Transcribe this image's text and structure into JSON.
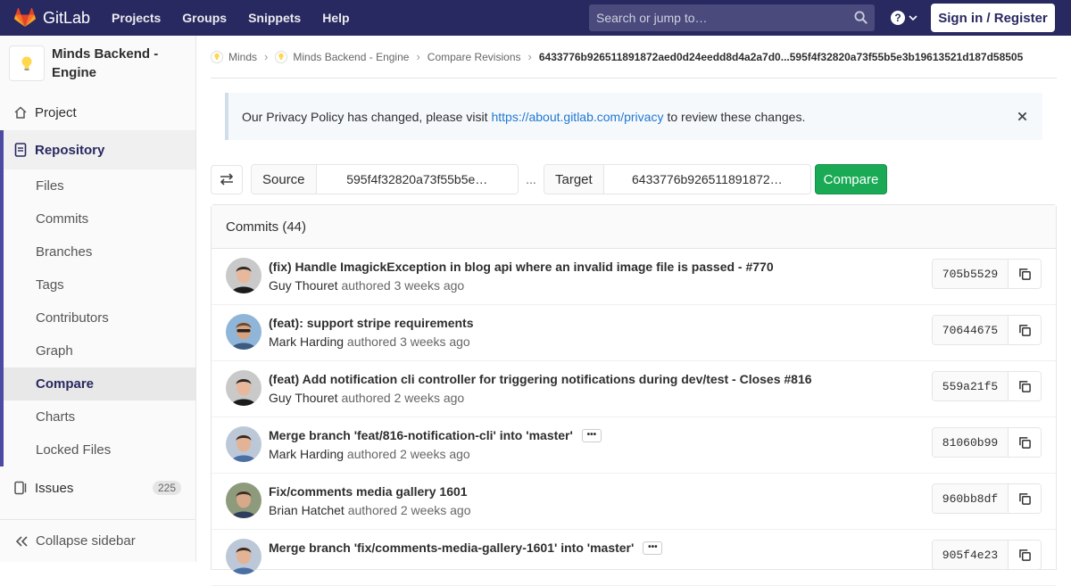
{
  "navbar": {
    "brand": "GitLab",
    "links": [
      "Projects",
      "Groups",
      "Snippets",
      "Help"
    ],
    "search_placeholder": "Search or jump to…",
    "signin": "Sign in / Register"
  },
  "sidebar": {
    "project_name": "Minds Backend - Engine",
    "project_label": "Project",
    "repository_label": "Repository",
    "repo_items": [
      "Files",
      "Commits",
      "Branches",
      "Tags",
      "Contributors",
      "Graph",
      "Compare",
      "Charts",
      "Locked Files"
    ],
    "current_item": "Compare",
    "issues_label": "Issues",
    "issues_count": "225",
    "collapse_label": "Collapse sidebar"
  },
  "breadcrumb": {
    "items": [
      "Minds",
      "Minds Backend - Engine",
      "Compare Revisions"
    ],
    "current": "6433776b926511891872aed0d24eedd8d4a2a7d0...595f4f32820a73f55b5e3b19613521d187d58505"
  },
  "alert": {
    "text_before": "Our Privacy Policy has changed, please visit",
    "link": "https://about.gitlab.com/privacy",
    "text_after": "to review these changes."
  },
  "compare": {
    "source_label": "Source",
    "source_value": "595f4f32820a73f55b5e…",
    "ellipsis": "...",
    "target_label": "Target",
    "target_value": "6433776b926511891872…",
    "button": "Compare"
  },
  "commits": {
    "header": "Commits (44)",
    "rows": [
      {
        "title": "(fix) Handle ImagickException in blog api where an invalid image file is passed - #770",
        "author": "Guy Thouret",
        "time": "authored 3 weeks ago",
        "sha": "705b5529",
        "avatar": "guy",
        "more": false
      },
      {
        "title": "(feat): support stripe requirements",
        "author": "Mark Harding",
        "time": "authored 3 weeks ago",
        "sha": "70644675",
        "avatar": "mark-sun",
        "more": false
      },
      {
        "title": "(feat) Add notification cli controller for triggering notifications during dev/test - Closes #816",
        "author": "Guy Thouret",
        "time": "authored 2 weeks ago",
        "sha": "559a21f5",
        "avatar": "guy",
        "more": false
      },
      {
        "title": "Merge branch 'feat/816-notification-cli' into 'master'",
        "author": "Mark Harding",
        "time": "authored 2 weeks ago",
        "sha": "81060b99",
        "avatar": "mark",
        "more": true
      },
      {
        "title": "Fix/comments media gallery 1601",
        "author": "Brian Hatchet",
        "time": "authored 2 weeks ago",
        "sha": "960bb8df",
        "avatar": "brian",
        "more": false
      },
      {
        "title": "Merge branch 'fix/comments-media-gallery-1601' into 'master'",
        "author": "",
        "time": "",
        "sha": "905f4e23",
        "avatar": "mark",
        "more": true
      }
    ]
  },
  "colors": {
    "navbar": "#292961",
    "accent": "#1aaa55",
    "link": "#1f78d1"
  }
}
